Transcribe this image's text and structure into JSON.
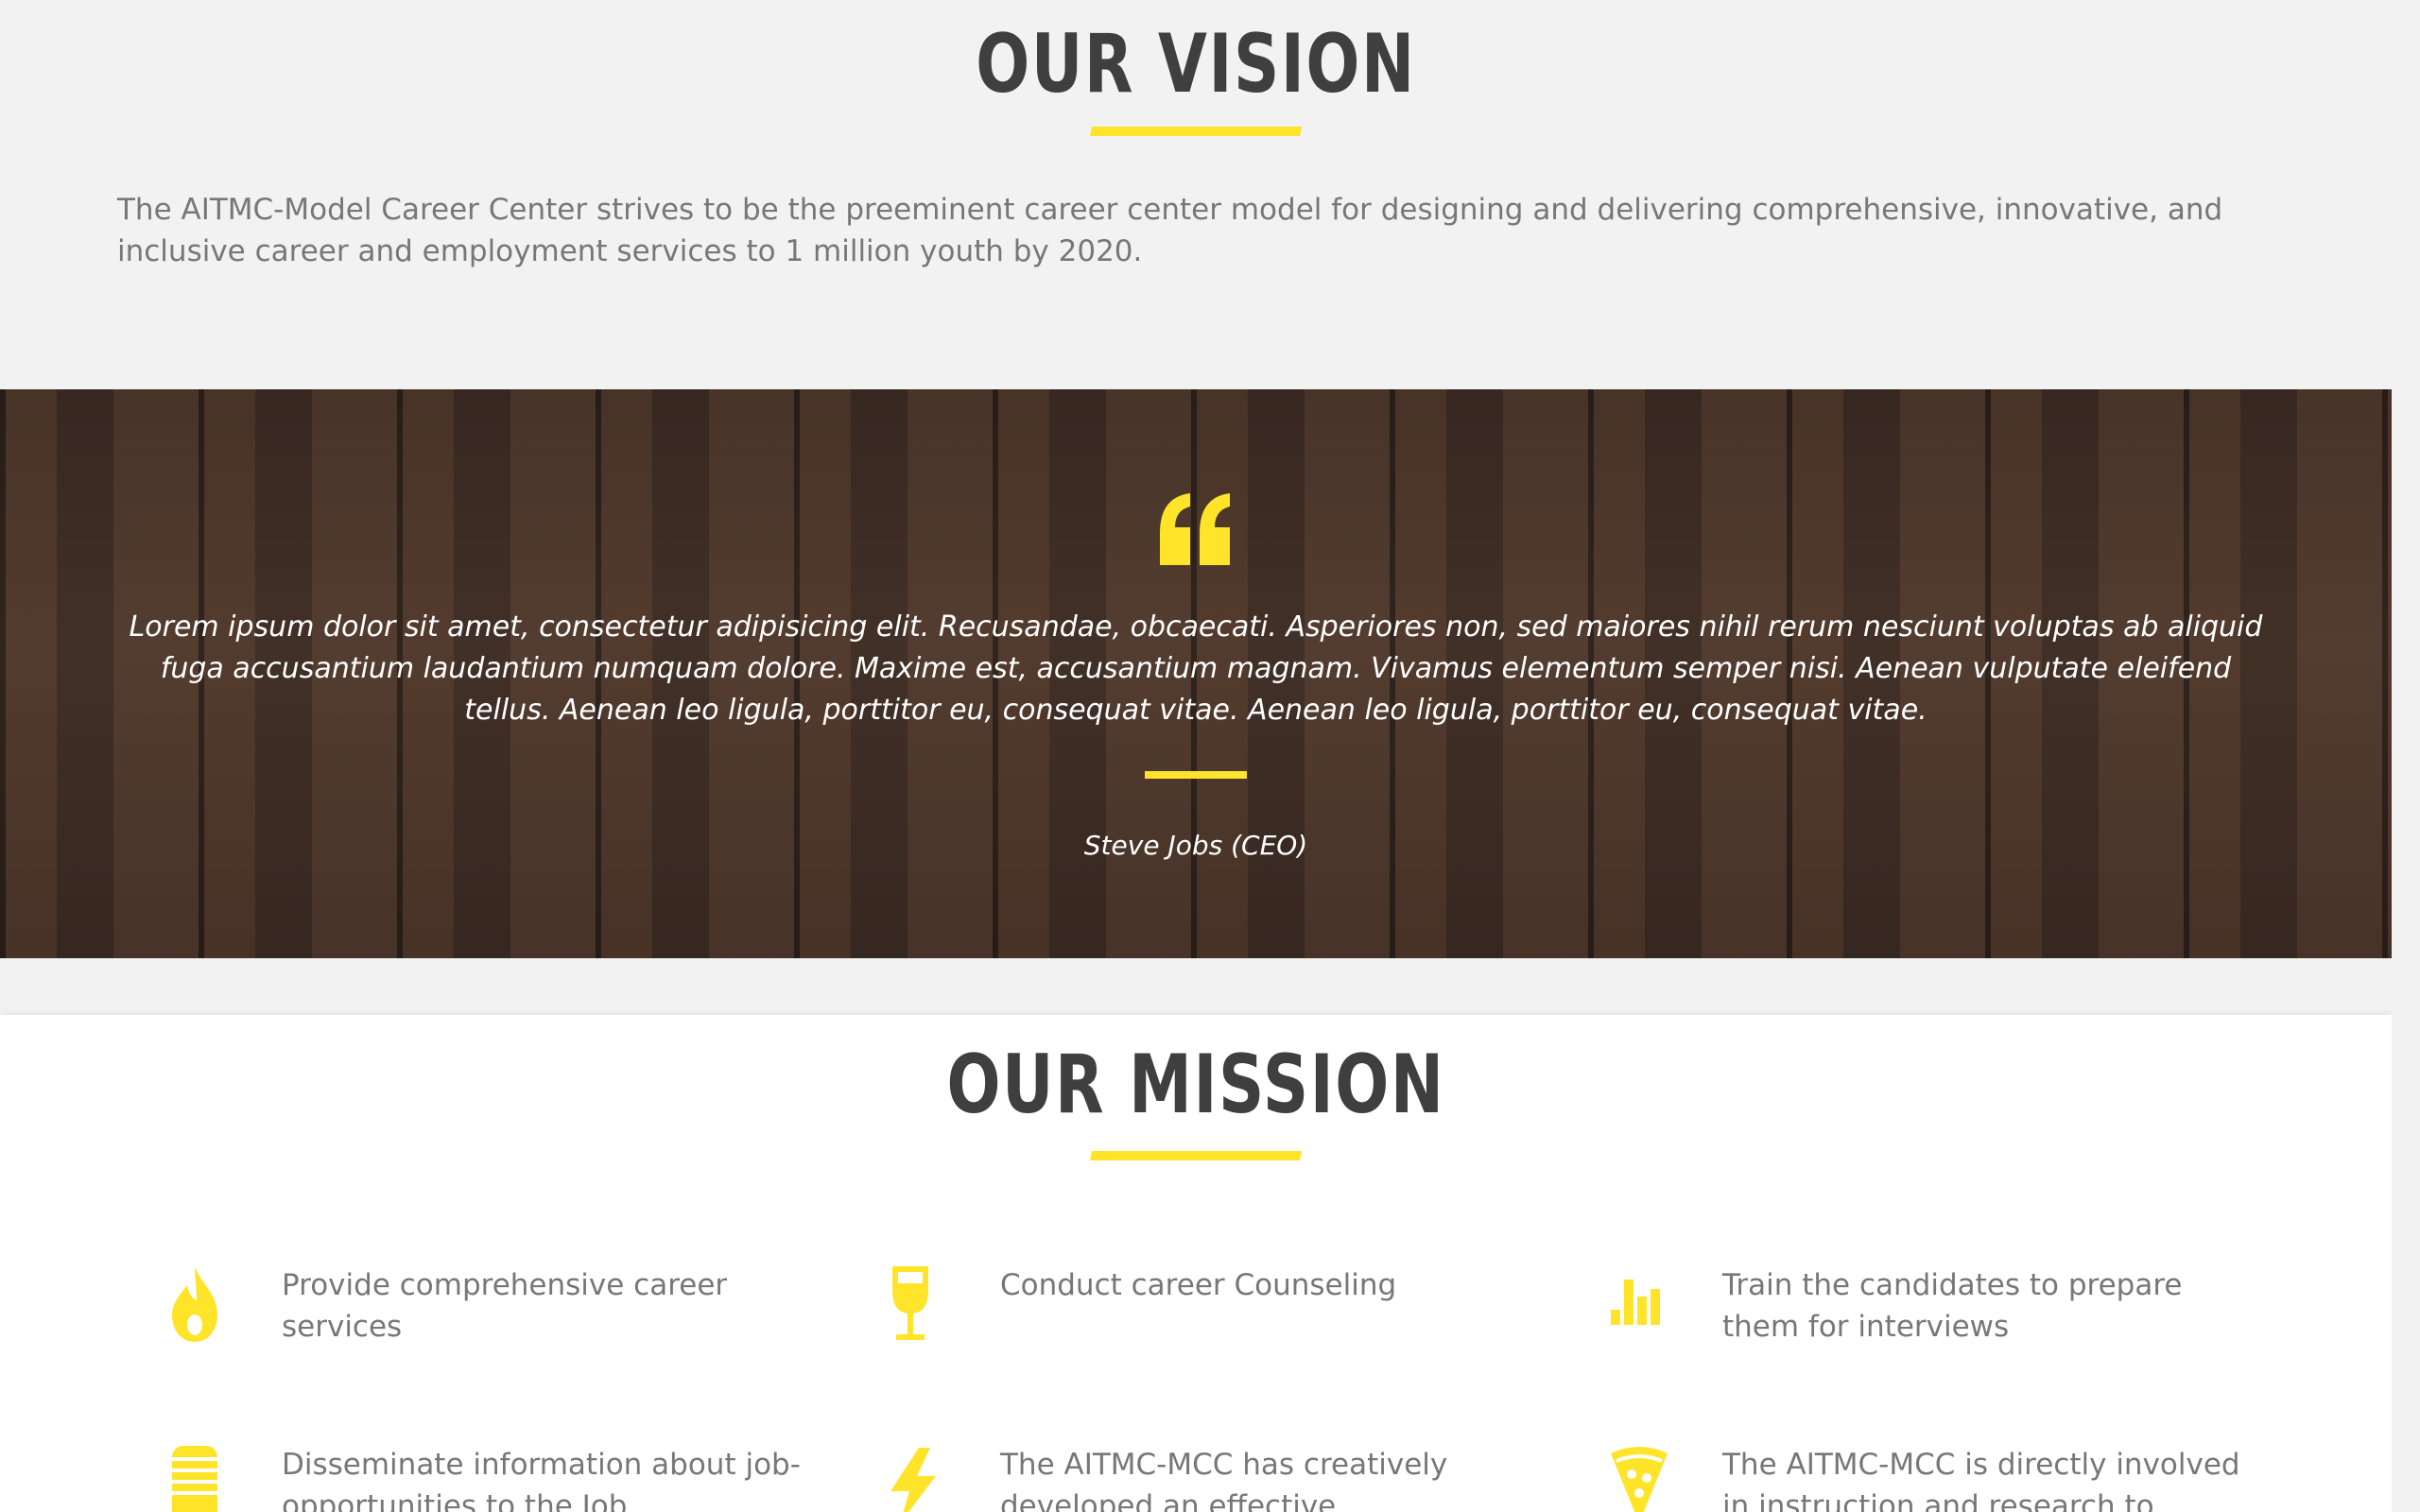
{
  "vision": {
    "title": "OUR VISION",
    "text": "The AITMC-Model Career Center strives to be the preeminent career center model for designing and delivering comprehensive, innovative, and inclusive career and employment services to 1 million youth by 2020."
  },
  "testimonial": {
    "quote_icon": "quote-icon",
    "text": "Lorem ipsum dolor sit amet, consectetur adipisicing elit. Recusandae, obcaecati. Asperiores non, sed maiores nihil rerum nesciunt voluptas ab aliquid fuga accusantium laudantium numquam dolore. Maxime est, accusantium magnam. Vivamus elementum semper nisi. Aenean vulputate eleifend tellus. Aenean leo ligula, porttitor eu, consequat vitae. Aenean leo ligula, porttitor eu, consequat vitae.",
    "author": "Steve Jobs (CEO)"
  },
  "mission": {
    "title": "OUR MISSION",
    "items": [
      {
        "icon": "flame-icon",
        "text": "Provide comprehensive career services"
      },
      {
        "icon": "wine-glass-icon",
        "text": "Conduct career Counseling"
      },
      {
        "icon": "bar-chart-icon",
        "text": "Train the candidates to prepare them for interviews"
      },
      {
        "icon": "microphone-icon",
        "text": "Disseminate information about job-opportunities to the Job"
      },
      {
        "icon": "lightning-icon",
        "text": "The AITMC-MCC has creatively developed an effective"
      },
      {
        "icon": "pizza-icon",
        "text": "The AITMC-MCC is directly involved in instruction and research to"
      }
    ]
  },
  "colors": {
    "accent": "#ffe42a",
    "heading": "#3f3f3f",
    "body_text": "#777777",
    "section_bg": "#f2f2f2"
  }
}
